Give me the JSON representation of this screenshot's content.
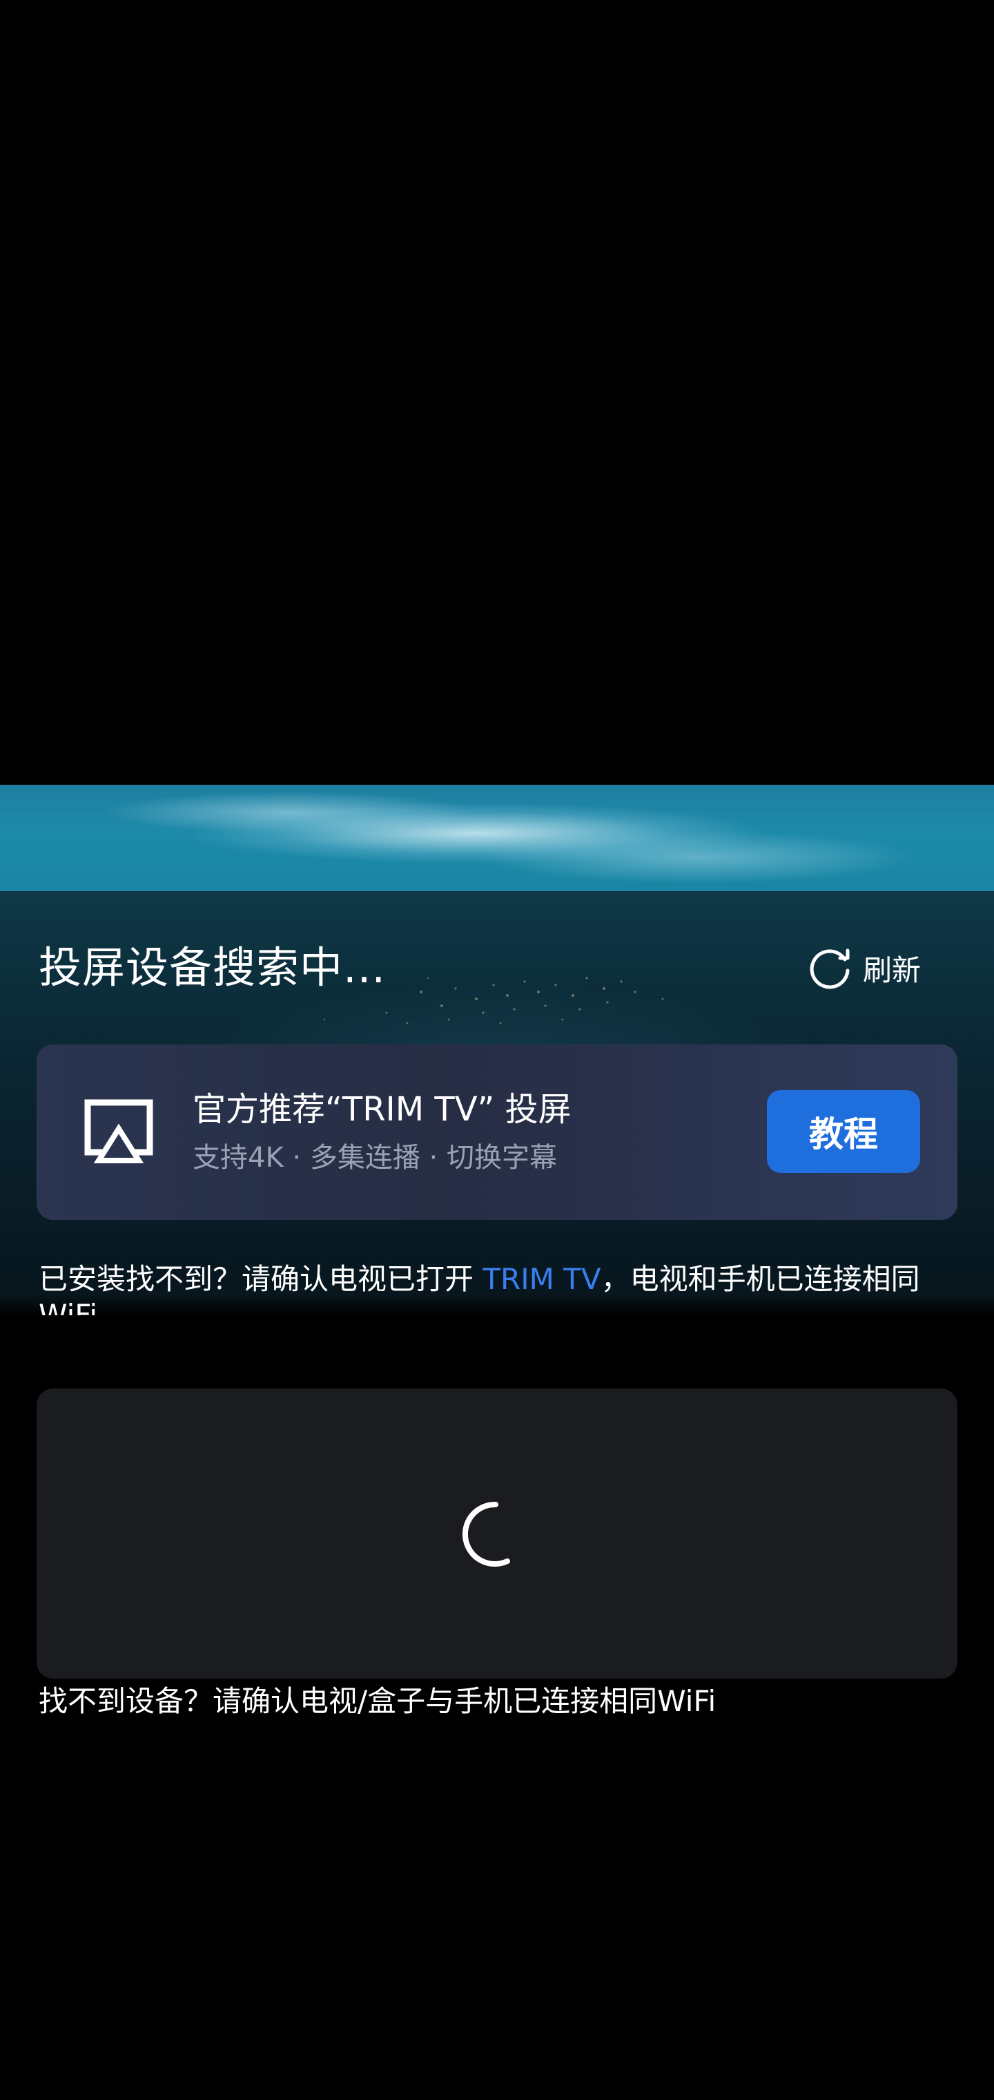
{
  "header": {
    "title": "投屏设备搜索中...",
    "refresh_label": "刷新",
    "refresh_icon": "refresh-icon"
  },
  "promo": {
    "icon": "airplay-icon",
    "title": "官方推荐“TRIM TV” 投屏",
    "subtitle": "支持4K · 多集连播 · 切换字幕",
    "button_label": "教程"
  },
  "install_hint": {
    "prefix": "已安装找不到？请确认电视已打开 ",
    "brand": "TRIM TV",
    "suffix": "，电视和手机已连接相同WiFi"
  },
  "device_list": {
    "status_icon": "loading-spinner-icon",
    "footer_hint": "找不到设备？请确认电视/盒子与手机已连接相同WiFi"
  },
  "colors": {
    "accent": "#1f6ede",
    "link": "#3a7ef0",
    "panel": "#1b1c20",
    "promo_card": "#2b3550"
  }
}
